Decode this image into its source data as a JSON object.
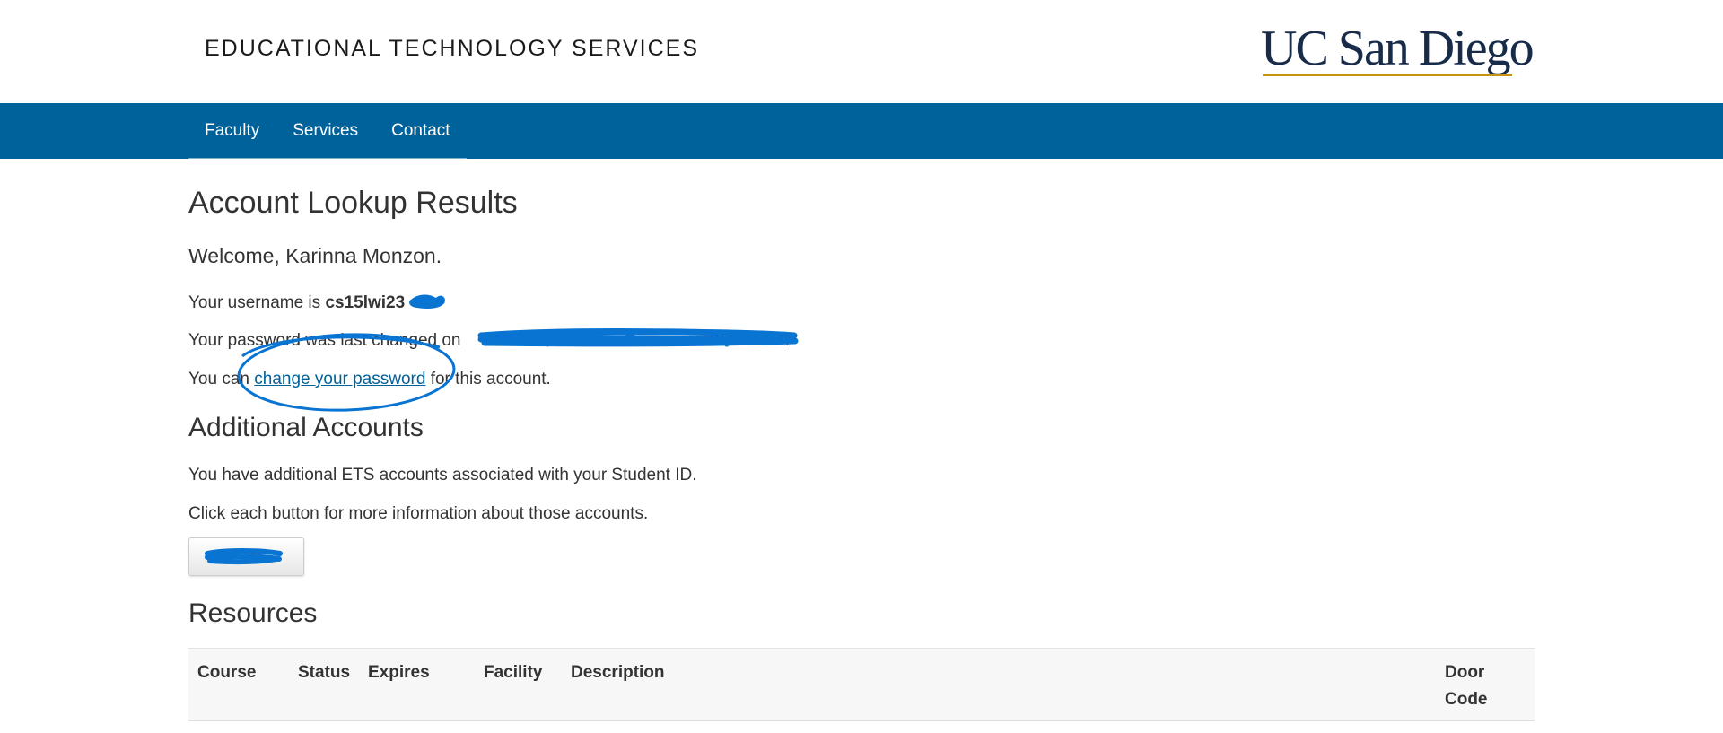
{
  "header": {
    "site_title": "EDUCATIONAL TECHNOLOGY SERVICES",
    "logo_text": "UC San Diego"
  },
  "nav": {
    "items": [
      {
        "label": "Faculty"
      },
      {
        "label": "Services"
      },
      {
        "label": "Contact"
      }
    ]
  },
  "main": {
    "page_title": "Account Lookup Results",
    "welcome": "Welcome, Karinna Monzon.",
    "username_prefix": "Your username is ",
    "username_value": "cs15lwi23",
    "password_prefix": "Your password was last changed on ",
    "password_suffix": ".",
    "change_prefix": "You can ",
    "change_link": "change your password",
    "change_suffix": " for this account.",
    "additional_heading": "Additional Accounts",
    "additional_text": "You have additional ETS accounts associated with your Student ID.",
    "click_text": "Click each button for more information about those accounts.",
    "resources_heading": "Resources"
  },
  "resources_table": {
    "headers": [
      "Course",
      "Status",
      "Expires",
      "Facility",
      "Description",
      "Door",
      "Code"
    ]
  },
  "colors": {
    "nav_bg": "#00629b",
    "logo_navy": "#182b49",
    "logo_gold": "#c69214",
    "scribble_blue": "#0a74d2"
  }
}
